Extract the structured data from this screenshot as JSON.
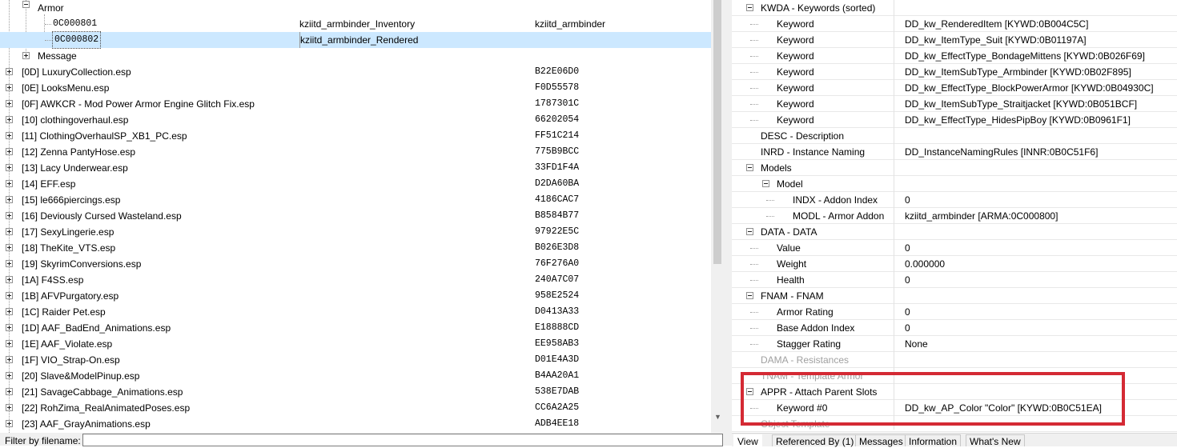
{
  "left_tree": {
    "armor_group": "Armor",
    "records": [
      {
        "form_id": "0C000801",
        "editor_id": "kziitd_armbinder_Inventory",
        "name": "kziitd_armbinder"
      },
      {
        "form_id": "0C000802",
        "editor_id": "kziitd_armbinder_Rendered",
        "name": ""
      }
    ],
    "message_group": "Message",
    "plugins": [
      {
        "name": "[0D] LuxuryCollection.esp",
        "crc": "B22E06D0"
      },
      {
        "name": "[0E] LooksMenu.esp",
        "crc": "F0D55578"
      },
      {
        "name": "[0F] AWKCR - Mod Power Armor Engine Glitch Fix.esp",
        "crc": "1787301C"
      },
      {
        "name": "[10] clothingoverhaul.esp",
        "crc": "66202054"
      },
      {
        "name": "[11] ClothingOverhaulSP_XB1_PC.esp",
        "crc": "FF51C214"
      },
      {
        "name": "[12] Zenna PantyHose.esp",
        "crc": "775B9BCC"
      },
      {
        "name": "[13] Lacy Underwear.esp",
        "crc": "33FD1F4A"
      },
      {
        "name": "[14] EFF.esp",
        "crc": "D2DA60BA"
      },
      {
        "name": "[15] le666piercings.esp",
        "crc": "4186CAC7"
      },
      {
        "name": "[16] Deviously Cursed Wasteland.esp",
        "crc": "B8584B77"
      },
      {
        "name": "[17] SexyLingerie.esp",
        "crc": "97922E5C"
      },
      {
        "name": "[18] TheKite_VTS.esp",
        "crc": "B026E3D8"
      },
      {
        "name": "[19] SkyrimConversions.esp",
        "crc": "76F276A0"
      },
      {
        "name": "[1A] F4SS.esp",
        "crc": "240A7C07"
      },
      {
        "name": "[1B] AFVPurgatory.esp",
        "crc": "958E2524"
      },
      {
        "name": "[1C] Raider Pet.esp",
        "crc": "D0413A33"
      },
      {
        "name": "[1D] AAF_BadEnd_Animations.esp",
        "crc": "E18888CD"
      },
      {
        "name": "[1E] AAF_Violate.esp",
        "crc": "EE958AB3"
      },
      {
        "name": "[1F] VIO_Strap-On.esp",
        "crc": "D01E4A3D"
      },
      {
        "name": "[20] Slave&ModelPinup.esp",
        "crc": "B4AA20A1"
      },
      {
        "name": "[21] SavageCabbage_Animations.esp",
        "crc": "538E7DAB"
      },
      {
        "name": "[22] RohZima_RealAnimatedPoses.esp",
        "crc": "CC6A2A25"
      },
      {
        "name": "[23] AAF_GrayAnimations.esp",
        "crc": "ADB4EE18"
      }
    ]
  },
  "filter": {
    "label": "Filter by filename:",
    "value": ""
  },
  "record_view": {
    "rows": [
      {
        "label": "KWDA - Keywords (sorted)",
        "value": "",
        "level": 0,
        "expander": "minus",
        "dim": false
      },
      {
        "label": "Keyword",
        "value": "DD_kw_RenderedItem [KYWD:0B004C5C]",
        "level": 1,
        "expander": "",
        "dim": false
      },
      {
        "label": "Keyword",
        "value": "DD_kw_ItemType_Suit [KYWD:0B01197A]",
        "level": 1,
        "expander": "",
        "dim": false
      },
      {
        "label": "Keyword",
        "value": "DD_kw_EffectType_BondageMittens [KYWD:0B026F69]",
        "level": 1,
        "expander": "",
        "dim": false
      },
      {
        "label": "Keyword",
        "value": "DD_kw_ItemSubType_Armbinder [KYWD:0B02F895]",
        "level": 1,
        "expander": "",
        "dim": false
      },
      {
        "label": "Keyword",
        "value": "DD_kw_EffectType_BlockPowerArmor [KYWD:0B04930C]",
        "level": 1,
        "expander": "",
        "dim": false
      },
      {
        "label": "Keyword",
        "value": "DD_kw_ItemSubType_Straitjacket [KYWD:0B051BCF]",
        "level": 1,
        "expander": "",
        "dim": false
      },
      {
        "label": "Keyword",
        "value": "DD_kw_EffectType_HidesPipBoy [KYWD:0B0961F1]",
        "level": 1,
        "expander": "",
        "dim": false
      },
      {
        "label": "DESC - Description",
        "value": "",
        "level": 0,
        "expander": "",
        "dim": false
      },
      {
        "label": "INRD - Instance Naming",
        "value": "DD_InstanceNamingRules [INNR:0B0C51F6]",
        "level": 0,
        "expander": "",
        "dim": false
      },
      {
        "label": "Models",
        "value": "",
        "level": 0,
        "expander": "minus",
        "dim": false
      },
      {
        "label": "Model",
        "value": "",
        "level": 1,
        "expander": "minus",
        "dim": false
      },
      {
        "label": "INDX - Addon Index",
        "value": "0",
        "level": 2,
        "expander": "",
        "dim": false
      },
      {
        "label": "MODL - Armor Addon",
        "value": "kziitd_armbinder [ARMA:0C000800]",
        "level": 2,
        "expander": "",
        "dim": false
      },
      {
        "label": "DATA - DATA",
        "value": "",
        "level": 0,
        "expander": "minus",
        "dim": false
      },
      {
        "label": "Value",
        "value": "0",
        "level": 1,
        "expander": "",
        "dim": false
      },
      {
        "label": "Weight",
        "value": "0.000000",
        "level": 1,
        "expander": "",
        "dim": false
      },
      {
        "label": "Health",
        "value": "0",
        "level": 1,
        "expander": "",
        "dim": false
      },
      {
        "label": "FNAM - FNAM",
        "value": "",
        "level": 0,
        "expander": "minus",
        "dim": false
      },
      {
        "label": "Armor Rating",
        "value": "0",
        "level": 1,
        "expander": "",
        "dim": false
      },
      {
        "label": "Base Addon Index",
        "value": "0",
        "level": 1,
        "expander": "",
        "dim": false
      },
      {
        "label": "Stagger Rating",
        "value": "None",
        "level": 1,
        "expander": "",
        "dim": false
      },
      {
        "label": "DAMA - Resistances",
        "value": "",
        "level": 0,
        "expander": "",
        "dim": true
      },
      {
        "label": "TNAM - Template Armor",
        "value": "",
        "level": 0,
        "expander": "",
        "dim": true
      },
      {
        "label": "APPR - Attach Parent Slots",
        "value": "",
        "level": 0,
        "expander": "minus",
        "dim": false
      },
      {
        "label": "Keyword #0",
        "value": "DD_kw_AP_Color \"Color\" [KYWD:0B0C51EA]",
        "level": 1,
        "expander": "",
        "dim": false
      },
      {
        "label": "Object Template",
        "value": "",
        "level": 0,
        "expander": "",
        "dim": true
      }
    ]
  },
  "tabs": [
    "View",
    "Referenced By (1)",
    "Messages",
    "Information",
    "What's New"
  ],
  "highlight_color": "#d42a34"
}
